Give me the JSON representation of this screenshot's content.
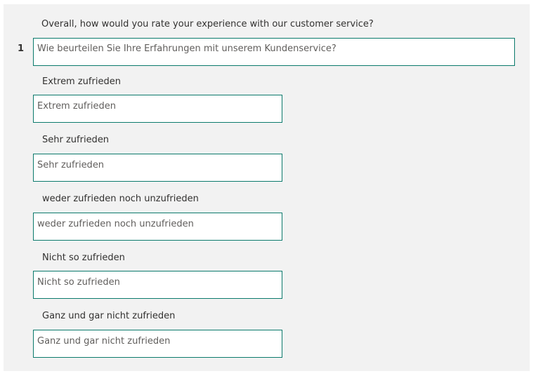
{
  "question": {
    "number": "1",
    "source_text": "Overall, how would you rate your experience with our customer service?",
    "translation_value": "Wie beurteilen Sie Ihre Erfahrungen mit unserem Kundenservice?"
  },
  "options": [
    {
      "source_text": "Extrem zufrieden",
      "translation_value": "Extrem zufrieden"
    },
    {
      "source_text": "Sehr zufrieden",
      "translation_value": "Sehr zufrieden"
    },
    {
      "source_text": "weder zufrieden noch unzufrieden",
      "translation_value": "weder zufrieden noch unzufrieden"
    },
    {
      "source_text": "Nicht so zufrieden",
      "translation_value": "Nicht so zufrieden"
    },
    {
      "source_text": "Ganz und gar nicht zufrieden",
      "translation_value": "Ganz und gar nicht zufrieden"
    }
  ],
  "colors": {
    "panel_background": "#f2f2f2",
    "field_border": "#0b7a6c"
  }
}
